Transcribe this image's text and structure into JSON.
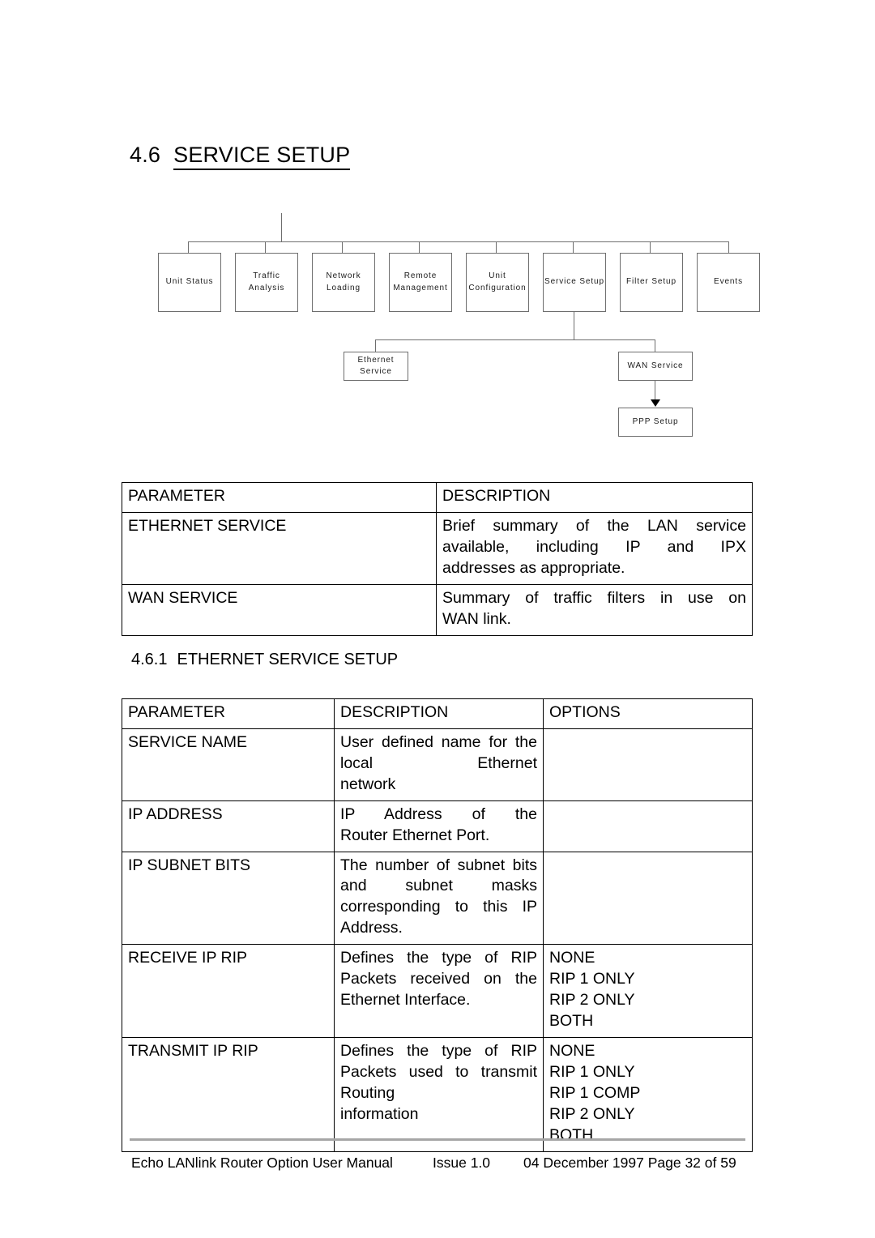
{
  "section": {
    "number": "4.6",
    "title": "SERVICE SETUP"
  },
  "subsection": {
    "number": "4.6.1",
    "title": "ETHERNET SERVICE SETUP"
  },
  "diagram": {
    "top_level": [
      "Unit Status",
      "Traffic Analysis",
      "Network Loading",
      "Remote Management",
      "Unit Configuration",
      "Service Setup",
      "Filter Setup",
      "Events"
    ],
    "children": [
      "Ethernet Service",
      "WAN Service"
    ],
    "grandchild": "PPP Setup"
  },
  "table_services": {
    "headers": [
      "PARAMETER",
      "DESCRIPTION"
    ],
    "rows": [
      {
        "parameter": "ETHERNET SERVICE",
        "description": "Brief summary of the LAN service available, including IP and IPX",
        "description_last": "addresses as appropriate."
      },
      {
        "parameter": "WAN SERVICE",
        "description": "Summary of traffic filters in use on",
        "description_last": "WAN link."
      }
    ]
  },
  "table_ethernet": {
    "headers": [
      "PARAMETER",
      "DESCRIPTION",
      "OPTIONS"
    ],
    "rows": [
      {
        "parameter": "SERVICE NAME",
        "description": "User defined name for the local Ethernet",
        "description_last": "network",
        "options": []
      },
      {
        "parameter": "IP ADDRESS",
        "description": "IP Address of the",
        "description_last": "Router Ethernet Port.",
        "options": []
      },
      {
        "parameter": "IP SUBNET BITS",
        "description": "The number of subnet bits and subnet masks corresponding to this IP",
        "description_last": "Address.",
        "options": []
      },
      {
        "parameter": "RECEIVE IP RIP",
        "description": "Defines the type of RIP Packets received on the",
        "description_last": "Ethernet Interface.",
        "options": [
          "NONE",
          "RIP 1 ONLY",
          "RIP 2 ONLY",
          "BOTH"
        ]
      },
      {
        "parameter": "TRANSMIT IP RIP",
        "description": "Defines the type of RIP Packets used to transmit Routing",
        "description_last": "information",
        "options": [
          "NONE",
          "RIP 1 ONLY",
          "RIP 1 COMP",
          "RIP 2 ONLY",
          "BOTH"
        ]
      }
    ]
  },
  "footer": {
    "manual": "Echo LANlink Router Option User Manual",
    "issue": "Issue 1.0",
    "date_page": "04 December 1997  Page 32 of 59"
  }
}
